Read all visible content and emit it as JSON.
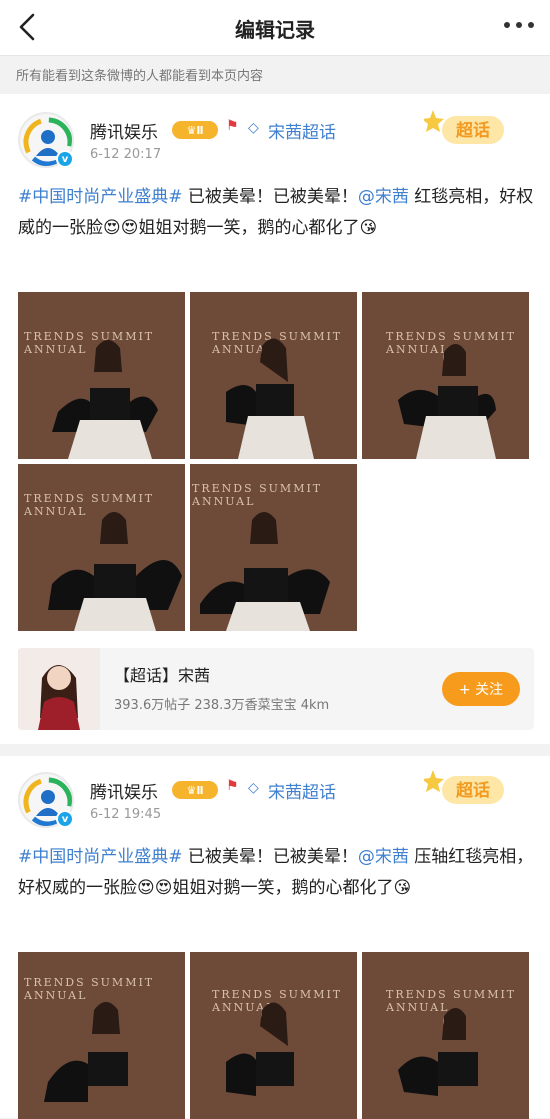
{
  "header": {
    "title": "编辑记录"
  },
  "notice": "所有能看到这条微博的人都能看到本页内容",
  "posts": [
    {
      "username": "腾讯娱乐",
      "level": "Ⅱ",
      "topic": "宋茜超话",
      "sticker": "超话",
      "time": "6-12 20:17",
      "text": {
        "hashtag": "#中国时尚产业盛典#",
        "body1": " 已被美晕！已被美晕！",
        "mention": "@宋茜",
        "body2": " 红毯亮相，好权威的一张脸😍😍姐姐对鹅一笑，鹅的心都化了😘"
      },
      "photos": [
        "TRENDS SUMMIT · ANNUAL",
        "TRENDS SUMMIT · ANNUAL",
        "TRENDS SUMMIT · ANNUAL",
        "TRENDS SUMMIT · ANNUAL",
        "TRENDS SUMMIT · ANNUAL"
      ]
    },
    {
      "username": "腾讯娱乐",
      "level": "Ⅱ",
      "topic": "宋茜超话",
      "sticker": "超话",
      "time": "6-12 19:45",
      "text": {
        "hashtag": "#中国时尚产业盛典#",
        "body1": " 已被美晕！已被美晕！",
        "mention": "@宋茜",
        "body2": " 压轴红毯亮相，好权威的一张脸😍😍姐姐对鹅一笑，鹅的心都化了😘"
      },
      "photos": [
        "TRENDS SUMMIT · ANNUAL",
        "TRENDS SUMMIT · ANNUAL",
        "TRENDS SUMMIT · ANNUAL"
      ]
    }
  ],
  "super_topic": {
    "title": "【超话】宋茜",
    "stats": "393.6万帖子 238.3万香菜宝宝 4km",
    "follow_label": "+ 关注"
  },
  "photo_captions": [
    "TRENDS SUMMIT",
    "ANNUAL"
  ]
}
